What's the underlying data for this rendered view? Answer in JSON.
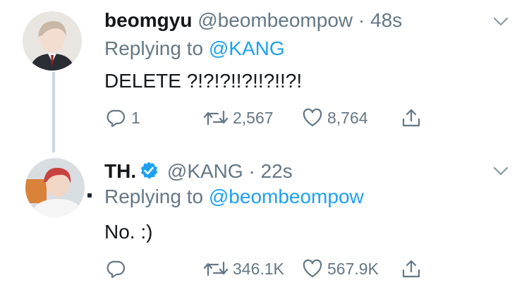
{
  "tweets": [
    {
      "name": "beomgyu",
      "handle": "@beombeompow",
      "separator": "·",
      "time": "48s",
      "replying_prefix": "Replying to",
      "replying_to": "@KANG",
      "text": "DELETE ?!?!?!!?!!?!!?!",
      "reply_count": "1",
      "retweet_count": "2,567",
      "like_count": "8,764",
      "verified": false
    },
    {
      "name": "TH.",
      "handle": "@KANG",
      "separator": "·",
      "time": "22s",
      "replying_prefix": "Replying to",
      "replying_to": "@beombeompow",
      "text": "No. :)",
      "reply_count": "",
      "retweet_count": "346.1K",
      "like_count": "567.9K",
      "verified": true
    }
  ],
  "colors": {
    "text": "#14171a",
    "secondary": "#657786",
    "accent": "#1da1f2",
    "thread_line": "#ccd6dd"
  },
  "icons": [
    "reply-icon",
    "retweet-icon",
    "like-icon",
    "share-icon",
    "chevron-down-icon",
    "verified-badge-icon"
  ]
}
